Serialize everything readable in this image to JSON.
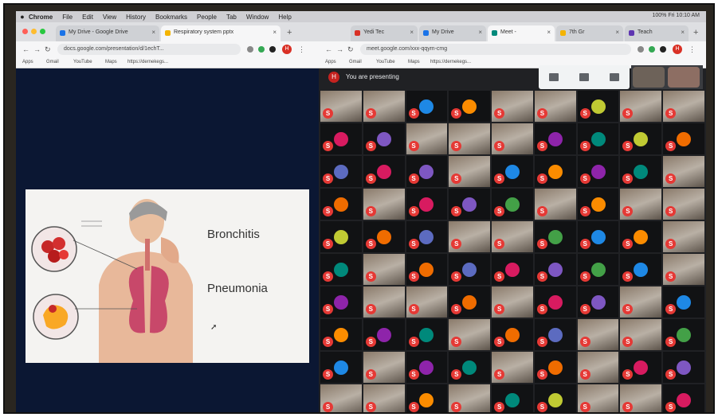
{
  "menubar": {
    "items": [
      "Chrome",
      "File",
      "Edit",
      "View",
      "History",
      "Bookmarks",
      "People",
      "Tab",
      "Window",
      "Help"
    ],
    "status": "100% Fri 10:10 AM"
  },
  "left_browser": {
    "tabs": [
      {
        "label": "My Drive - Google Drive",
        "favicon": "#1a73e8",
        "active": false
      },
      {
        "label": "Respiratory system pptx",
        "favicon": "#f4b400",
        "active": true
      }
    ],
    "url": "docs.google.com/presentation/d/1echT...",
    "bookmarks": [
      "Apps",
      "Gmail",
      "YouTube",
      "Maps",
      "https://dernekegs..."
    ]
  },
  "slide": {
    "items": [
      "Bronchitis",
      "Pneumonia"
    ]
  },
  "right_browser": {
    "tabs": [
      {
        "label": "Yedi Tec",
        "favicon": "#d93025",
        "active": false
      },
      {
        "label": "My Drive",
        "favicon": "#1a73e8",
        "active": false
      },
      {
        "label": "Meet -",
        "favicon": "#00897b",
        "active": true
      },
      {
        "label": "7th Gr",
        "favicon": "#f4b400",
        "active": false
      },
      {
        "label": "Teach",
        "favicon": "#5e35b1",
        "active": false
      }
    ],
    "url": "meet.google.com/xxx-qqym-cmg",
    "bookmarks": [
      "Apps",
      "Gmail",
      "YouTube",
      "Maps",
      "https://dernekegs..."
    ],
    "presenting_avatar": "H",
    "presenting_text": "You are presenting"
  },
  "participants": {
    "badge_letter": "S",
    "tiles": [
      "S",
      "S",
      "S",
      "S",
      "S",
      "S",
      "S",
      "S",
      "S",
      "S",
      "S",
      "S",
      "S",
      "S",
      "S",
      "S",
      "S",
      "S",
      "S",
      "S",
      "S",
      "S",
      "S",
      "S",
      "S",
      "S",
      "S",
      "S",
      "S",
      "S",
      "S",
      "S",
      "S",
      "S",
      "S",
      "S",
      "S",
      "S",
      "S",
      "S",
      "S",
      "S",
      "S",
      "S",
      "S",
      "S",
      "S",
      "S",
      "S",
      "S",
      "S",
      "S",
      "S",
      "S",
      "S",
      "S",
      "S",
      "S",
      "S",
      "S",
      "S",
      "S",
      "S",
      "S",
      "S",
      "S",
      "S",
      "S",
      "S",
      "S",
      "S",
      "S",
      "S",
      "S",
      "S",
      "S",
      "S",
      "S",
      "S",
      "S",
      "S",
      "S",
      "S",
      "S",
      "S",
      "S",
      "S",
      "S",
      "S",
      "S"
    ]
  },
  "colors": {
    "accent_red": "#e53935",
    "slide_bg": "#0b1733"
  }
}
